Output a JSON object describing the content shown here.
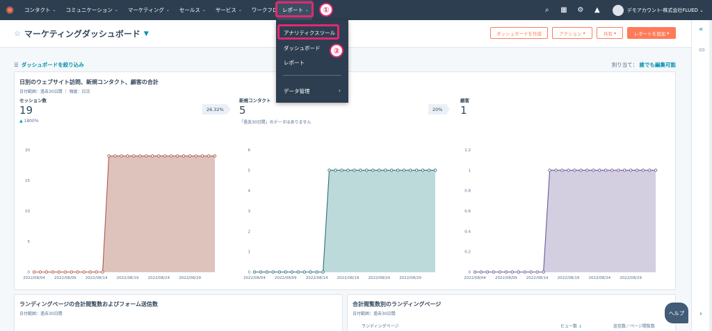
{
  "nav": {
    "items": [
      {
        "label": "コンタクト"
      },
      {
        "label": "コミュニケーション"
      },
      {
        "label": "マーケティング"
      },
      {
        "label": "セールス"
      },
      {
        "label": "サービス"
      },
      {
        "label": "ワークフロー"
      }
    ],
    "active_label": "レポート",
    "account": "デモアカウント-株式会社FLUED"
  },
  "annotations": {
    "step1": "①",
    "step2": "②"
  },
  "dropdown": {
    "items": [
      "アナリティクスツール",
      "ダッシュボード",
      "レポート"
    ],
    "data_mgmt": "データ管理"
  },
  "header": {
    "title": "マーケティングダッシュボード",
    "btn_create": "ダッシュボードを作成",
    "btn_action": "アクション",
    "btn_share": "共有",
    "btn_add": "レポートを追加"
  },
  "filter": {
    "label": "ダッシュボードを絞り込み",
    "assign_label": "割り当て：",
    "assign_value": "誰でも編集可能"
  },
  "card1": {
    "title": "日別のウェブサイト訪問、新規コンタクト、顧客の合計",
    "sub": "日付範囲：過去30日間 ｜ 頻度：日次",
    "metrics": [
      {
        "label": "セッション数",
        "value": "19",
        "note": "1800%",
        "delta": "26.32%"
      },
      {
        "label": "新規コンタクト",
        "value": "5",
        "note": "「過去30日間」のデータはありません",
        "delta": "20%"
      },
      {
        "label": "顧客",
        "value": "1"
      }
    ]
  },
  "chart_data": [
    {
      "type": "area",
      "ylim": [
        0,
        20
      ],
      "yticks": [
        "0",
        "5",
        "10",
        "15",
        "20"
      ],
      "x_labels": [
        "2022/08/04",
        "2022/08/09",
        "2022/08/14",
        "2022/08/19",
        "2022/08/24",
        "2022/08/29"
      ],
      "values": [
        0,
        0,
        0,
        0,
        0,
        0,
        0,
        0,
        0,
        0,
        0,
        0,
        19,
        19,
        19,
        19,
        19,
        19,
        19,
        19,
        19,
        19,
        19,
        19,
        19,
        19,
        19,
        19,
        19,
        19
      ],
      "color": "#b1564a",
      "fill": "#d8b8b1"
    },
    {
      "type": "area",
      "ylim": [
        0,
        6
      ],
      "yticks": [
        "0",
        "1",
        "2",
        "3",
        "4",
        "5",
        "6"
      ],
      "x_labels": [
        "2022/08/04",
        "2022/08/09",
        "2022/08/14",
        "2022/08/19",
        "2022/08/24",
        "2022/08/29"
      ],
      "values": [
        0,
        0,
        0,
        0,
        0,
        0,
        0,
        0,
        0,
        0,
        0,
        0,
        5,
        5,
        5,
        5,
        5,
        5,
        5,
        5,
        5,
        5,
        5,
        5,
        5,
        5,
        5,
        5,
        5,
        5
      ],
      "color": "#2c6f78",
      "fill": "#b2d4d4"
    },
    {
      "type": "area",
      "ylim": [
        0,
        1.2
      ],
      "yticks": [
        "0",
        "0.2",
        "0.4",
        "0.6",
        "0.8",
        "1",
        "1.2"
      ],
      "x_labels": [
        "2022/08/04",
        "2022/08/09",
        "2022/08/14",
        "2022/08/19",
        "2022/08/24",
        "2022/08/29"
      ],
      "values": [
        0,
        0,
        0,
        0,
        0,
        0,
        0,
        0,
        0,
        0,
        0,
        0,
        1,
        1,
        1,
        1,
        1,
        1,
        1,
        1,
        1,
        1,
        1,
        1,
        1,
        1,
        1,
        1,
        1,
        1
      ],
      "color": "#6a5a95",
      "fill": "#ccc6dc"
    }
  ],
  "card2": {
    "title": "ランディングページの合計閲覧数およびフォーム送信数",
    "sub": "日付範囲：過去30日間"
  },
  "card3": {
    "title": "合計閲覧数別のランディングページ",
    "sub": "日付範囲：過去30日間",
    "col1": "ランディングページ",
    "col2": "ビュー数",
    "col3": "送信数／ページ閲覧数"
  },
  "help": "ヘルプ"
}
